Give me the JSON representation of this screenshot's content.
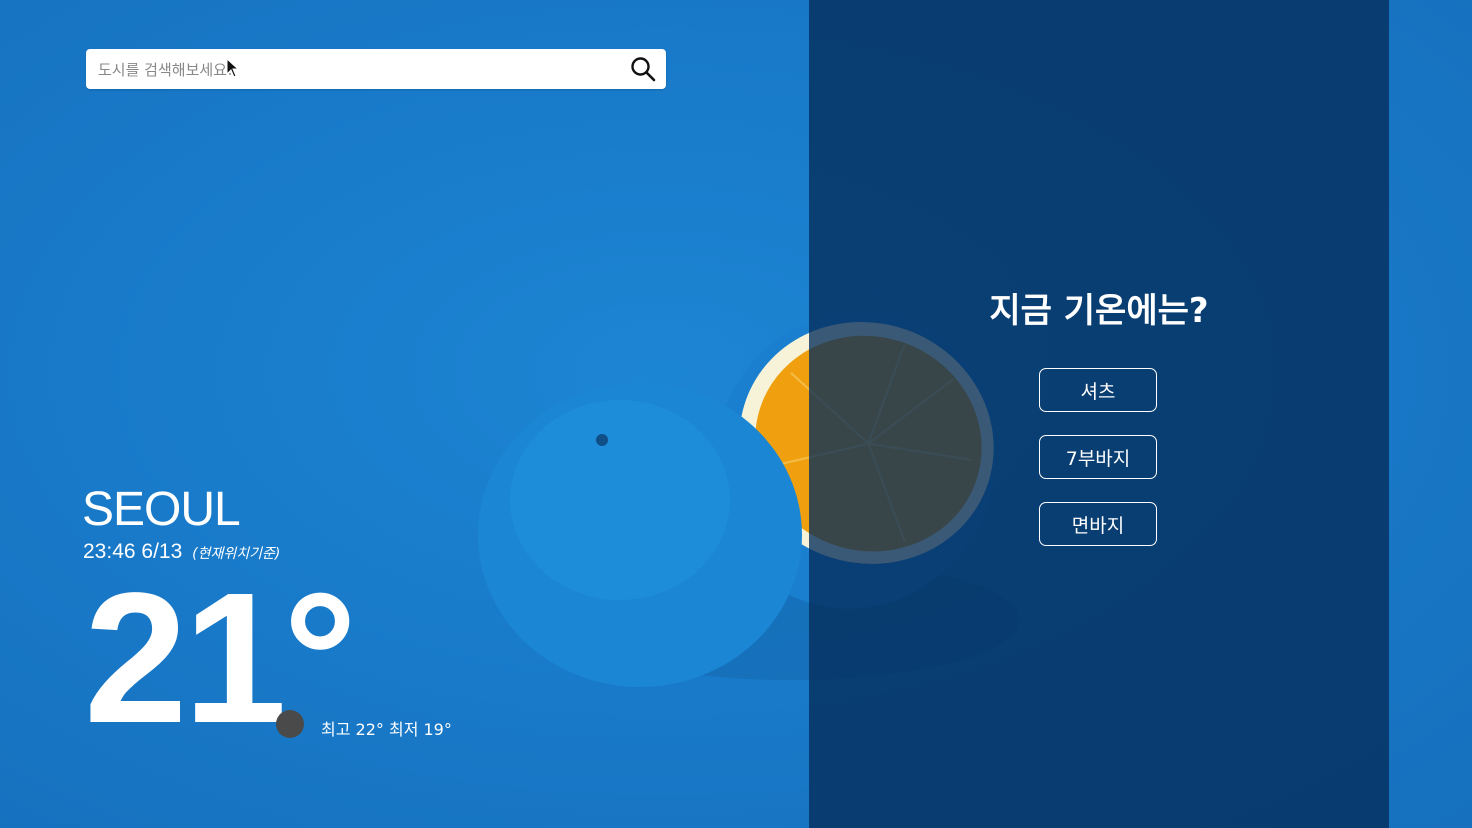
{
  "search": {
    "placeholder": "도시를 검색해보세요!",
    "icon": "search-icon"
  },
  "weather": {
    "city": "SEOUL",
    "time": "23:46 6/13",
    "location_note": "(현재위치기준)",
    "temperature": "21°",
    "condition_icon": "weather-condition-icon",
    "high_low": "최고 22° 최저 19°"
  },
  "recommend": {
    "title": "지금 기온에는?",
    "items": [
      "셔츠",
      "7부바지",
      "면바지"
    ]
  },
  "colors": {
    "background": "#1a7ccc",
    "panel": "#0a3a6c",
    "orange": "#f0a00f",
    "text": "#ffffff"
  }
}
